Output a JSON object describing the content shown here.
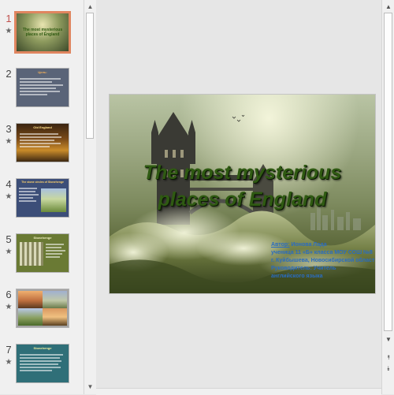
{
  "thumbnails": [
    {
      "number": "1",
      "has_animation": true,
      "selected": true,
      "title": "The most mysterious places of England"
    },
    {
      "number": "2",
      "has_animation": false,
      "selected": false,
      "title": "Цель:"
    },
    {
      "number": "3",
      "has_animation": true,
      "selected": false,
      "title": "Old England"
    },
    {
      "number": "4",
      "has_animation": true,
      "selected": false,
      "title": "The stone circles of Stonehenge"
    },
    {
      "number": "5",
      "has_animation": true,
      "selected": false,
      "title": "Stonehenge"
    },
    {
      "number": "6",
      "has_animation": true,
      "selected": false,
      "title": ""
    },
    {
      "number": "7",
      "has_animation": true,
      "selected": false,
      "title": "Stonehenge"
    }
  ],
  "animation_marker": "★",
  "slide": {
    "title_line1": "The most mysterious",
    "title_line2": "places of England",
    "author_label": "Автор:",
    "author_name": " Ионова Лада",
    "author_lines": [
      "ученица 11 «Б» класса МОУ СОШ №8",
      "г. Куйбышева, Новосибирской области",
      "Руководитель: Учитель",
      "английского языка"
    ]
  },
  "scrollbar_icons": {
    "up": "▲",
    "down": "▼",
    "prev_slide": "⯭",
    "next_slide": "⯯"
  },
  "colors": {
    "selected_border": "#e0855f",
    "selected_number": "#c0504d",
    "title_green": "#2f5a12",
    "author_blue": "#2a6cc0"
  }
}
